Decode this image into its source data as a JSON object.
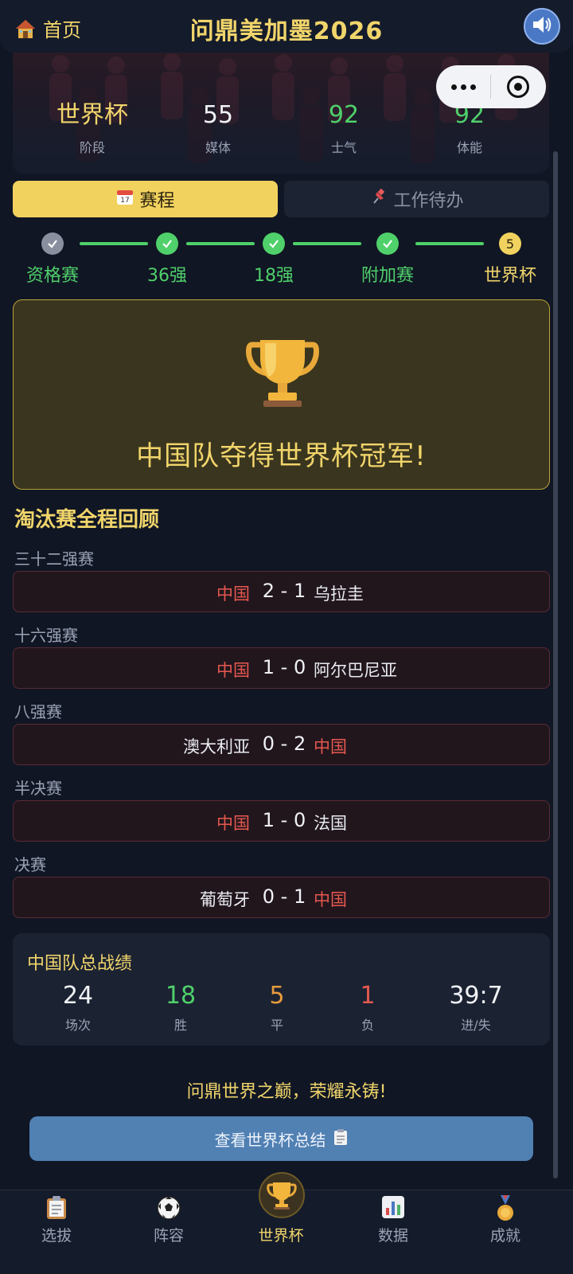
{
  "header": {
    "home_label": "首页",
    "title": "问鼎美加墨2026"
  },
  "hero_stats": [
    {
      "value": "世界杯",
      "label": "阶段",
      "color": "#f1d56b"
    },
    {
      "value": "55",
      "label": "媒体",
      "color": "#f0f2f6"
    },
    {
      "value": "92",
      "label": "士气",
      "color": "#4fd06a"
    },
    {
      "value": "92",
      "label": "体能",
      "color": "#4fd06a"
    }
  ],
  "tabs": [
    {
      "icon": "calendar-icon",
      "label": "赛程",
      "active": true
    },
    {
      "icon": "pushpin-icon",
      "label": "工作待办",
      "active": false
    }
  ],
  "progress": [
    {
      "label": "资格赛",
      "status": "done-gray"
    },
    {
      "label": "36强",
      "status": "done"
    },
    {
      "label": "18强",
      "status": "done"
    },
    {
      "label": "附加赛",
      "status": "done"
    },
    {
      "label": "世界杯",
      "status": "current",
      "number": "5"
    }
  ],
  "banner": {
    "icon": "trophy-icon",
    "title": "中国队夺得世界杯冠军!"
  },
  "knockout": {
    "title": "淘汰赛全程回顾",
    "rounds": [
      {
        "round": "三十二强赛",
        "home": "中国",
        "score": "2 - 1",
        "away": "乌拉圭",
        "china_side": "home"
      },
      {
        "round": "十六强赛",
        "home": "中国",
        "score": "1 - 0",
        "away": "阿尔巴尼亚",
        "china_side": "home"
      },
      {
        "round": "八强赛",
        "home": "澳大利亚",
        "score": "0 - 2",
        "away": "中国",
        "china_side": "away"
      },
      {
        "round": "半决赛",
        "home": "中国",
        "score": "1 - 0",
        "away": "法国",
        "china_side": "home"
      },
      {
        "round": "决赛",
        "home": "葡萄牙",
        "score": "0 - 1",
        "away": "中国",
        "china_side": "away"
      }
    ]
  },
  "summary": {
    "title": "中国队总战绩",
    "items": [
      {
        "value": "24",
        "label": "场次",
        "color": "#f0f2f6"
      },
      {
        "value": "18",
        "label": "胜",
        "color": "#4fd06a"
      },
      {
        "value": "5",
        "label": "平",
        "color": "#e69a3c"
      },
      {
        "value": "1",
        "label": "负",
        "color": "#e4584f"
      },
      {
        "value": "39:7",
        "label": "进/失",
        "color": "#f0f2f6"
      }
    ]
  },
  "motto": "问鼎世界之巅，荣耀永铸!",
  "cta": {
    "label": "查看世界杯总结",
    "icon": "clipboard-icon"
  },
  "bottom_nav": [
    {
      "label": "选拔",
      "icon": "clipboard-icon"
    },
    {
      "label": "阵容",
      "icon": "soccer-ball-icon"
    },
    {
      "label": "世界杯",
      "icon": "trophy-icon",
      "active": true
    },
    {
      "label": "数据",
      "icon": "bar-chart-icon"
    },
    {
      "label": "成就",
      "icon": "medal-icon"
    }
  ],
  "colors": {
    "accent_gold": "#f1d56b",
    "success_green": "#4fd06a",
    "china_red": "#e4584f",
    "background": "#101624"
  }
}
